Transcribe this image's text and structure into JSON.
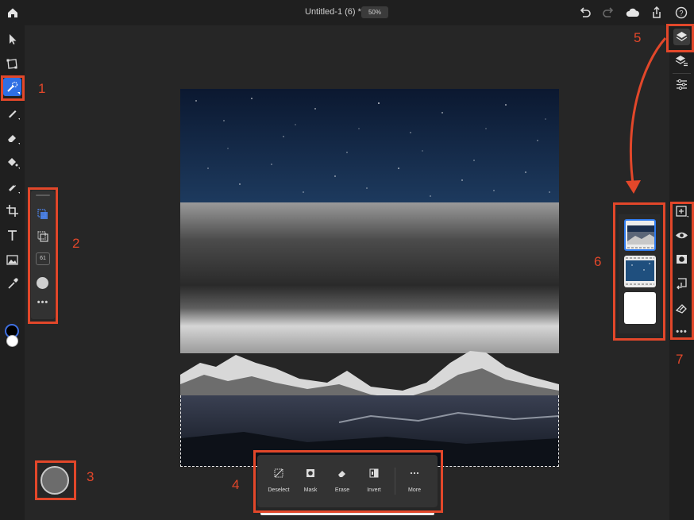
{
  "header": {
    "doc_title": "Untitled-1 (6) *",
    "zoom": "50%"
  },
  "left_toolbar": {
    "tools": [
      "select-arrow-icon",
      "transform-icon",
      "quick-selection-icon",
      "brush-icon",
      "eraser-icon",
      "paint-bucket-icon",
      "healing-brush-icon",
      "crop-icon",
      "type-icon",
      "place-image-icon",
      "eyedropper-icon"
    ],
    "active_tool": "quick-selection-icon",
    "foreground_color": "#000000",
    "background_color": "#ffffff"
  },
  "tool_options": {
    "brush_size": "61",
    "more": "•••"
  },
  "selection_bar": {
    "items": [
      {
        "label": "Deselect",
        "icon": "deselect-icon"
      },
      {
        "label": "Mask",
        "icon": "mask-icon"
      },
      {
        "label": "Erase",
        "icon": "erase-icon"
      },
      {
        "label": "Invert",
        "icon": "invert-icon"
      }
    ],
    "more_label": "More"
  },
  "right_toolbar": {
    "top_icons": [
      "layers-icon",
      "layer-properties-icon",
      "adjustments-icon"
    ],
    "layer_actions": [
      "add-layer-icon",
      "visibility-eye-icon",
      "mask-layer-icon",
      "merge-down-icon",
      "clear-layer-icon"
    ],
    "more": "•••"
  },
  "layers_panel": {
    "count": 3,
    "selected_index": 0
  },
  "annotations": {
    "labels": [
      "1",
      "2",
      "3",
      "4",
      "5",
      "6",
      "7"
    ],
    "color": "#e2472a"
  },
  "colors": {
    "accent": "#2f6fe4",
    "chrome": "#1f1f1f",
    "workspace": "#262626"
  }
}
